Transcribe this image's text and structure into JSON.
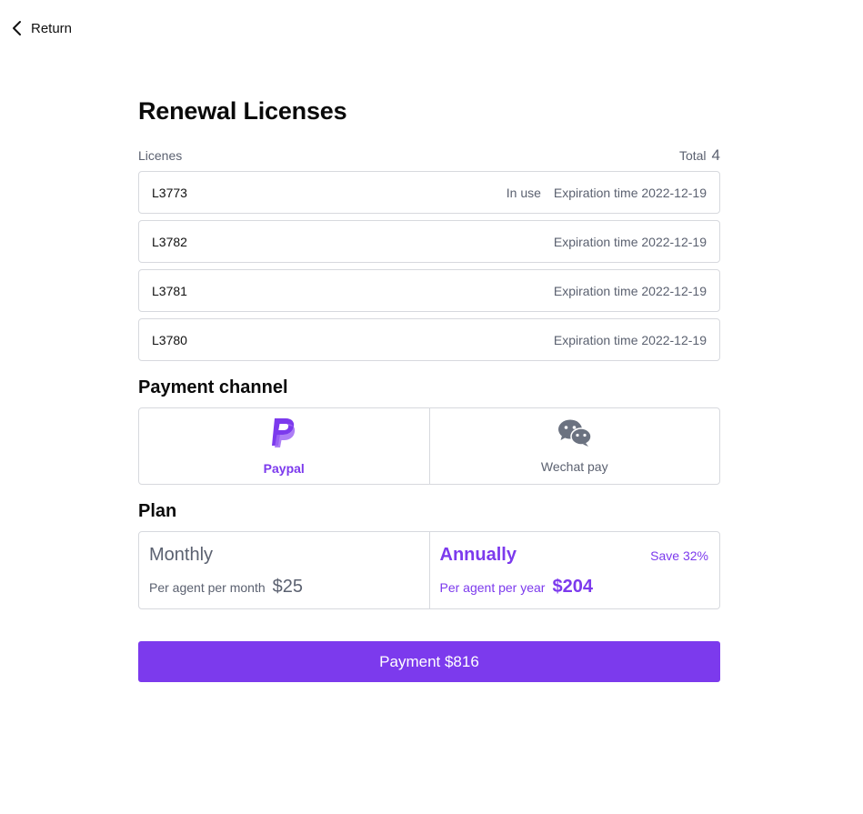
{
  "nav": {
    "return_label": "Return"
  },
  "page": {
    "title": "Renewal Licenses"
  },
  "licenses": {
    "header_label": "Licenes",
    "total_label": "Total",
    "total_count": "4",
    "items": [
      {
        "id": "L3773",
        "status": "In use",
        "expiration": "Expiration time 2022-12-19"
      },
      {
        "id": "L3782",
        "status": "",
        "expiration": "Expiration time 2022-12-19"
      },
      {
        "id": "L3781",
        "status": "",
        "expiration": "Expiration time 2022-12-19"
      },
      {
        "id": "L3780",
        "status": "",
        "expiration": "Expiration time 2022-12-19"
      }
    ]
  },
  "payment_channel": {
    "title": "Payment channel",
    "options": [
      {
        "label": "Paypal",
        "icon": "paypal-icon",
        "selected": true
      },
      {
        "label": "Wechat pay",
        "icon": "wechat-icon",
        "selected": false
      }
    ]
  },
  "plan": {
    "title": "Plan",
    "options": [
      {
        "name": "Monthly",
        "per": "Per agent per month",
        "price": "$25",
        "badge": "",
        "selected": false
      },
      {
        "name": "Annually",
        "per": "Per agent per year",
        "price": "$204",
        "badge": "Save 32%",
        "selected": true
      }
    ]
  },
  "payment_button": {
    "label": "Payment $816"
  },
  "colors": {
    "accent": "#7c3aed",
    "border": "#d7d9de",
    "muted_text": "#5b6170",
    "wechat_icon": "#6b7280"
  }
}
